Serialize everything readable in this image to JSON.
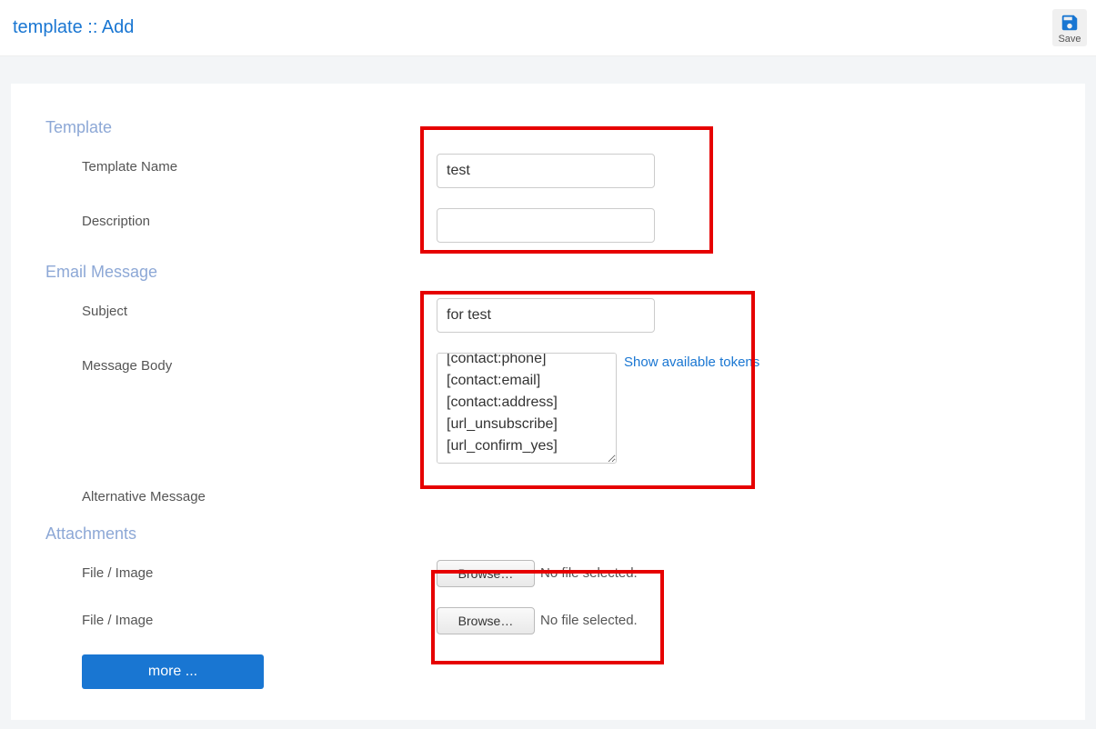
{
  "header": {
    "title": "template :: Add",
    "save_label": "Save"
  },
  "sections": {
    "template": {
      "title": "Template",
      "name_label": "Template Name",
      "name_value": "test",
      "desc_label": "Description",
      "desc_value": ""
    },
    "email": {
      "title": "Email Message",
      "subject_label": "Subject",
      "subject_value": "for test",
      "body_label": "Message Body",
      "body_value": "[contact:phone]\n[contact:email]\n[contact:address]\n[url_unsubscribe]\n[url_confirm_yes]",
      "tokens_link": "Show available tokens",
      "alt_label": "Alternative Message"
    },
    "attachments": {
      "title": "Attachments",
      "file_label": "File / Image",
      "browse_label": "Browse…",
      "no_file": "No file selected.",
      "more_label": "more ..."
    }
  }
}
